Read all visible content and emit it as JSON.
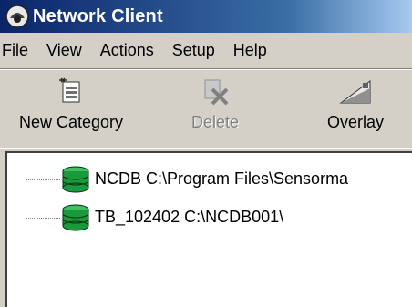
{
  "window": {
    "title": "Network Client"
  },
  "menu": [
    "File",
    "View",
    "Actions",
    "Setup",
    "Help"
  ],
  "toolbar": {
    "new_category": "New Category",
    "delete": "Delete",
    "overlay": "Overlay"
  },
  "tree": {
    "items": [
      {
        "label": "NCDB C:\\Program Files\\Sensorma"
      },
      {
        "label": "TB_102402 C:\\NCDB001\\"
      }
    ]
  },
  "colors": {
    "titlebar": "#0a246a",
    "db_icon": "#1a9a3a",
    "chrome": "#d4d0c8"
  }
}
